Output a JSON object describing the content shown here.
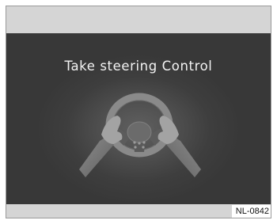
{
  "display": {
    "message": "Take steering Control",
    "icon": "steering-wheel-hands-icon"
  },
  "figure": {
    "reference_code": "NL-0842"
  },
  "colors": {
    "display_background": "#3a3a3a",
    "bezel": "#d5d5d5",
    "message_text": "#f3f3f3"
  }
}
